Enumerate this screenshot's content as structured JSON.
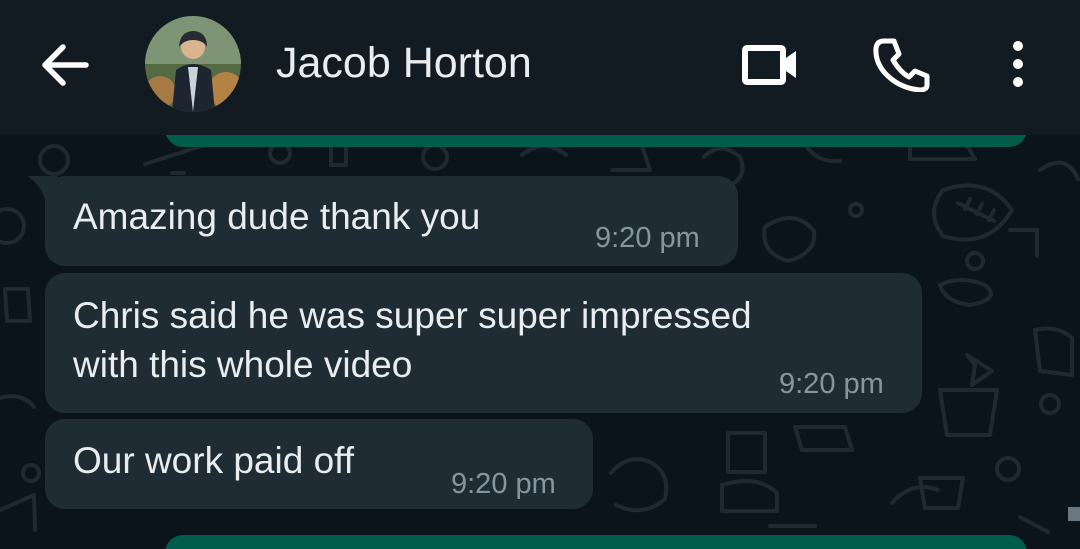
{
  "header": {
    "contact_name": "Jacob Horton",
    "icons": [
      "back-arrow-icon",
      "avatar",
      "video-call-icon",
      "voice-call-icon",
      "more-options-icon"
    ]
  },
  "messages": [
    {
      "text_lines": [
        "Amazing dude thank you"
      ],
      "time": "9:20 pm"
    },
    {
      "text_lines": [
        "Chris said he was super super impressed",
        "with this whole video"
      ],
      "time": "9:20 pm"
    },
    {
      "text_lines": [
        "Our work paid off"
      ],
      "time": "9:20 pm"
    }
  ],
  "colors": {
    "header_bg": "#111b21",
    "chat_bg": "#0b141a",
    "incoming_bubble": "#202c33",
    "outgoing_bubble": "#005c4b",
    "text": "#e9edef",
    "time": "#8696a0"
  }
}
